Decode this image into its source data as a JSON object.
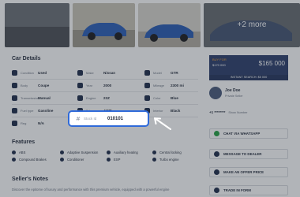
{
  "gallery": {
    "more_label": "+2 more"
  },
  "car_details": {
    "title": "Car Details",
    "rows": [
      [
        {
          "label": "Condition",
          "value": "Used",
          "icon": "car-icon"
        },
        {
          "label": "Make",
          "value": "Nissan",
          "icon": "brand-icon"
        },
        {
          "label": "Model",
          "value": "GTR",
          "icon": "model-icon"
        }
      ],
      [
        {
          "label": "Body",
          "value": "Coupe",
          "icon": "body-icon"
        },
        {
          "label": "Year",
          "value": "2000",
          "icon": "calendar-icon"
        },
        {
          "label": "Mileage",
          "value": "2300 mi",
          "icon": "gauge-icon"
        }
      ],
      [
        {
          "label": "Transmission",
          "value": "Manual",
          "icon": "gearbox-icon"
        },
        {
          "label": "Engine",
          "value": "23Z",
          "icon": "engine-icon"
        },
        {
          "label": "Color",
          "value": "Blue",
          "icon": "palette-icon"
        }
      ],
      [
        {
          "label": "Fuel type",
          "value": "Gasoline",
          "icon": "fuel-icon"
        },
        {
          "label": "Drive",
          "value": "AWD",
          "icon": "drive-icon"
        },
        {
          "label": "Interior",
          "value": "Black",
          "icon": "seat-icon"
        }
      ],
      [
        {
          "label": "Reg",
          "value": "N/A",
          "icon": "document-icon"
        },
        {
          "label": "",
          "value": "",
          "icon": ""
        },
        {
          "label": "",
          "value": "",
          "icon": ""
        }
      ]
    ]
  },
  "stock_field": {
    "icon": "#",
    "label": "Stock Id",
    "value": "010101"
  },
  "features": {
    "title": "Features",
    "items": [
      "ABS",
      "Adaptive Suspension",
      "Auxiliary heating",
      "Central locking",
      "Compound Brakes",
      "Conditioner",
      "ESP",
      "Turbo engine"
    ]
  },
  "sellers_notes": {
    "title": "Seller's Notes",
    "text": "Discover the epitome of luxury and performance with this premium vehicle, equipped with a powerful engine"
  },
  "price_card": {
    "buy_for": "BUY FOR",
    "old_price": "$170 000",
    "price": "$165 000",
    "instant_label": "INSTANT SEARCH: $5 000"
  },
  "seller": {
    "name": "Joe Doe",
    "subtitle": "Private Seller",
    "phone": "+1 ********",
    "reveal": "Show Number"
  },
  "actions": [
    {
      "label": "CHAT VIA WHATSAPP",
      "icon": "whatsapp-icon",
      "color": "#25a244"
    },
    {
      "label": "MESSAGE TO DEALER",
      "icon": "mail-icon",
      "color": "#1f2c4a"
    },
    {
      "label": "MAKE AN OFFER PRICE",
      "icon": "tag-icon",
      "color": "#1f2c4a"
    },
    {
      "label": "TRADE IN FORM",
      "icon": "swap-icon",
      "color": "#1f2c4a"
    }
  ]
}
